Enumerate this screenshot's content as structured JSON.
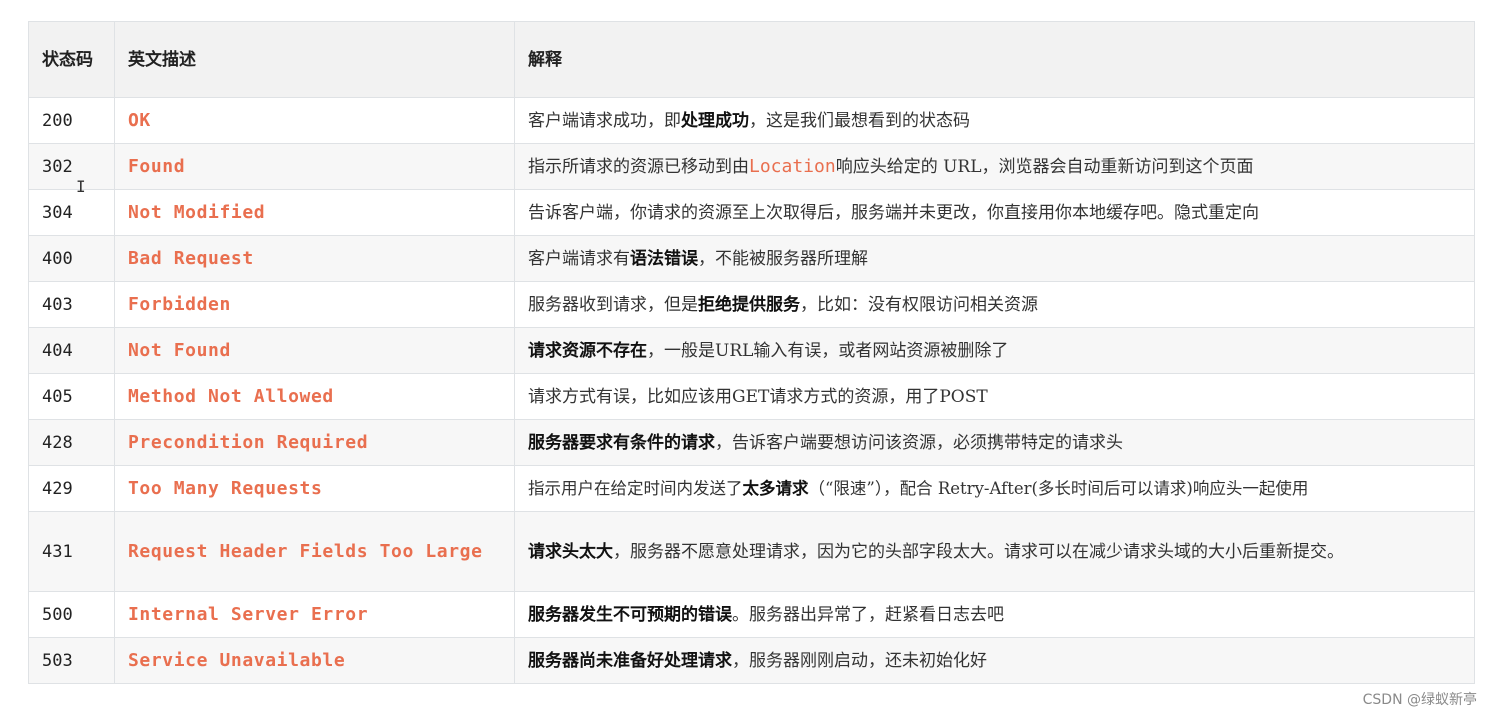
{
  "header": {
    "code": "状态码",
    "name": "英文描述",
    "desc": "解释"
  },
  "rows": [
    {
      "code": "200",
      "name": "OK",
      "desc_parts": [
        "客户端请求成功，即",
        "处理成功",
        "，这是我们最想看到的状态码"
      ]
    },
    {
      "code": "302",
      "name": "Found",
      "desc_parts": [
        "指示所请求的资源已移动到由",
        "Location",
        "响应头给定的 URL，浏览器会自动重新访问到这个页面"
      ]
    },
    {
      "code": "304",
      "name": "Not Modified",
      "desc_parts": [
        "告诉客户端，你请求的资源至上次取得后，服务端并未更改，你直接用你本地缓存吧。隐式重定向"
      ]
    },
    {
      "code": "400",
      "name": "Bad Request",
      "desc_parts": [
        "客户端请求有",
        "语法错误",
        "，不能被服务器所理解"
      ]
    },
    {
      "code": "403",
      "name": "Forbidden",
      "desc_parts": [
        "服务器收到请求，但是",
        "拒绝提供服务",
        "，比如：没有权限访问相关资源"
      ]
    },
    {
      "code": "404",
      "name": "Not Found",
      "desc_parts": [
        "请求资源不存在",
        "，一般是URL输入有误，或者网站资源被删除了"
      ]
    },
    {
      "code": "405",
      "name": "Method Not Allowed",
      "desc_parts": [
        "请求方式有误，比如应该用GET请求方式的资源，用了POST"
      ]
    },
    {
      "code": "428",
      "name": "Precondition Required",
      "desc_parts": [
        "服务器要求有条件的请求",
        "，告诉客户端要想访问该资源，必须携带特定的请求头"
      ]
    },
    {
      "code": "429",
      "name": "Too Many Requests",
      "desc_parts": [
        "指示用户在给定时间内发送了",
        "太多请求",
        "（“限速”），配合 Retry-After(多长时间后可以请求)响应头一起使用"
      ]
    },
    {
      "code": "431",
      "name": "Request Header Fields Too Large",
      "desc_parts": [
        "请求头太大",
        "，服务器不愿意处理请求，因为它的头部字段太大。请求可以在减少请求头域的大小后重新提交。"
      ]
    },
    {
      "code": "500",
      "name": "Internal Server Error",
      "desc_parts": [
        "服务器发生不可预期的错误",
        "。服务器出异常了，赶紧看日志去吧"
      ]
    },
    {
      "code": "503",
      "name": "Service Unavailable",
      "desc_parts": [
        "服务器尚未准备好处理请求",
        "，服务器刚刚启动，还未初始化好"
      ]
    }
  ],
  "watermark": "CSDN @绿蚁新亭",
  "colors": {
    "name_text": "#e96f4f",
    "header_bg": "#f2f2f2",
    "stripe_bg": "#f7f7f7",
    "border": "#dfe2e5"
  }
}
